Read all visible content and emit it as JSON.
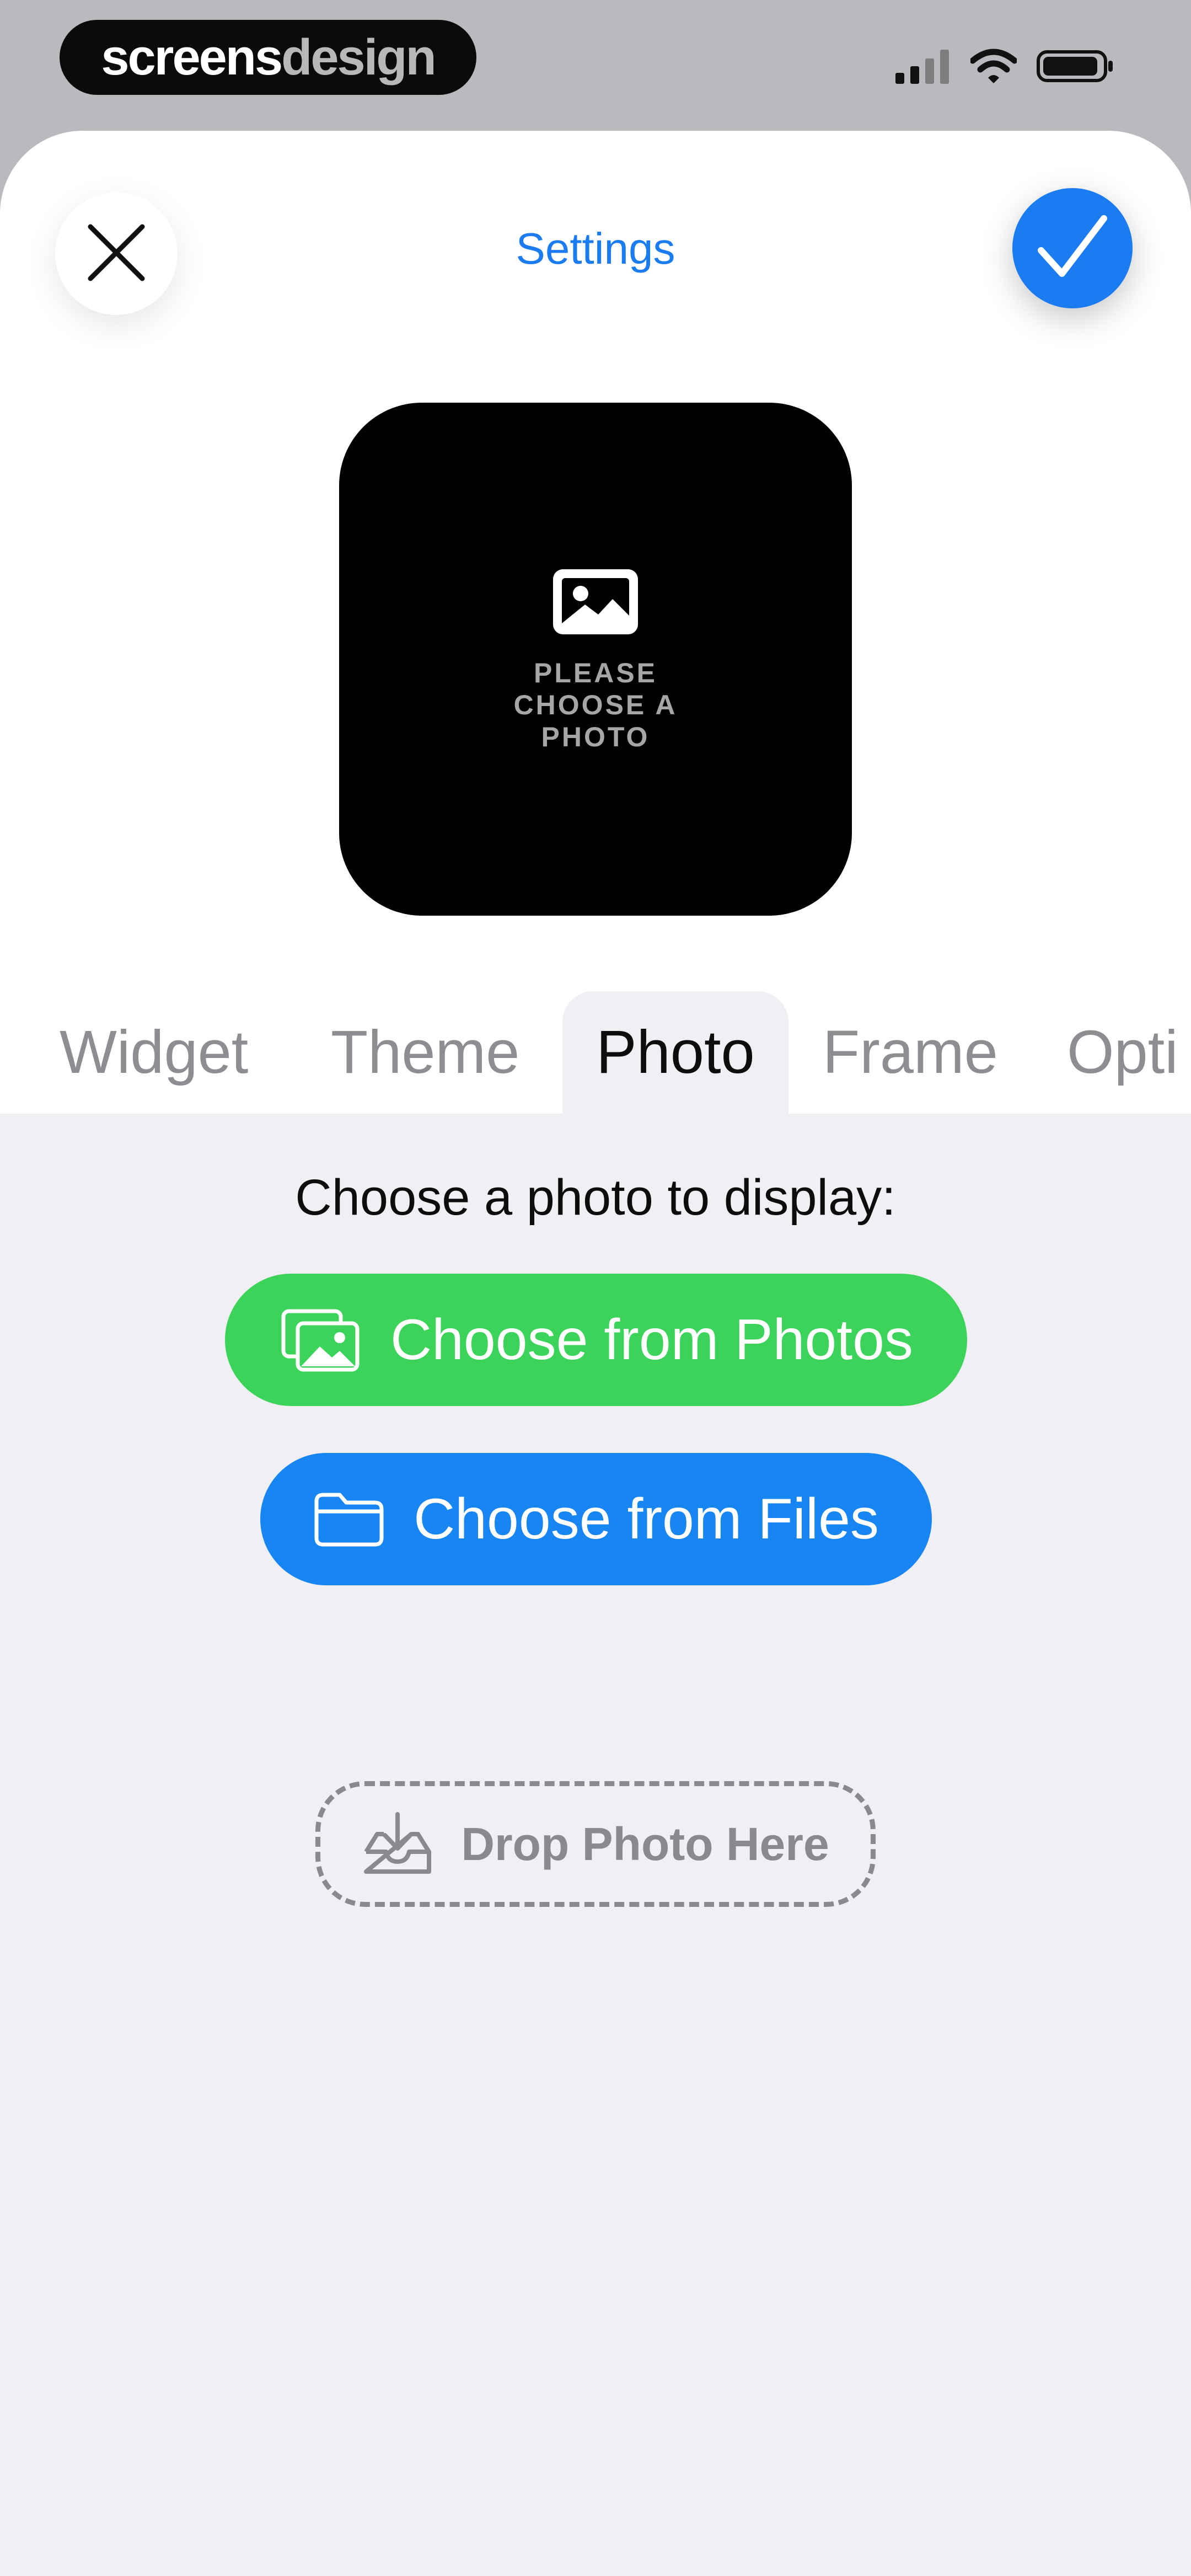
{
  "status_bar": {
    "brand_primary": "screens",
    "brand_secondary": "design",
    "icons": [
      "signal-icon",
      "wifi-icon",
      "battery-icon"
    ]
  },
  "header": {
    "title": "Settings",
    "close_icon": "close-icon",
    "confirm_icon": "checkmark-icon",
    "accent_color": "#1a7cf0"
  },
  "preview": {
    "icon": "image-icon",
    "placeholder_text": "PLEASE CHOOSE A PHOTO"
  },
  "tabs": [
    {
      "label": "Widget",
      "active": false
    },
    {
      "label": "Theme",
      "active": false
    },
    {
      "label": "Photo",
      "active": true
    },
    {
      "label": "Frame",
      "active": false
    },
    {
      "label": "Opti",
      "active": false
    }
  ],
  "photo_panel": {
    "prompt": "Choose a photo to display:",
    "photos_button": {
      "label": "Choose from Photos",
      "icon": "photos-icon",
      "color": "#3cd35a"
    },
    "files_button": {
      "label": "Choose from Files",
      "icon": "folder-icon",
      "color": "#1785f2"
    },
    "drop_zone": {
      "label": "Drop Photo Here",
      "icon": "tray-download-icon"
    }
  }
}
